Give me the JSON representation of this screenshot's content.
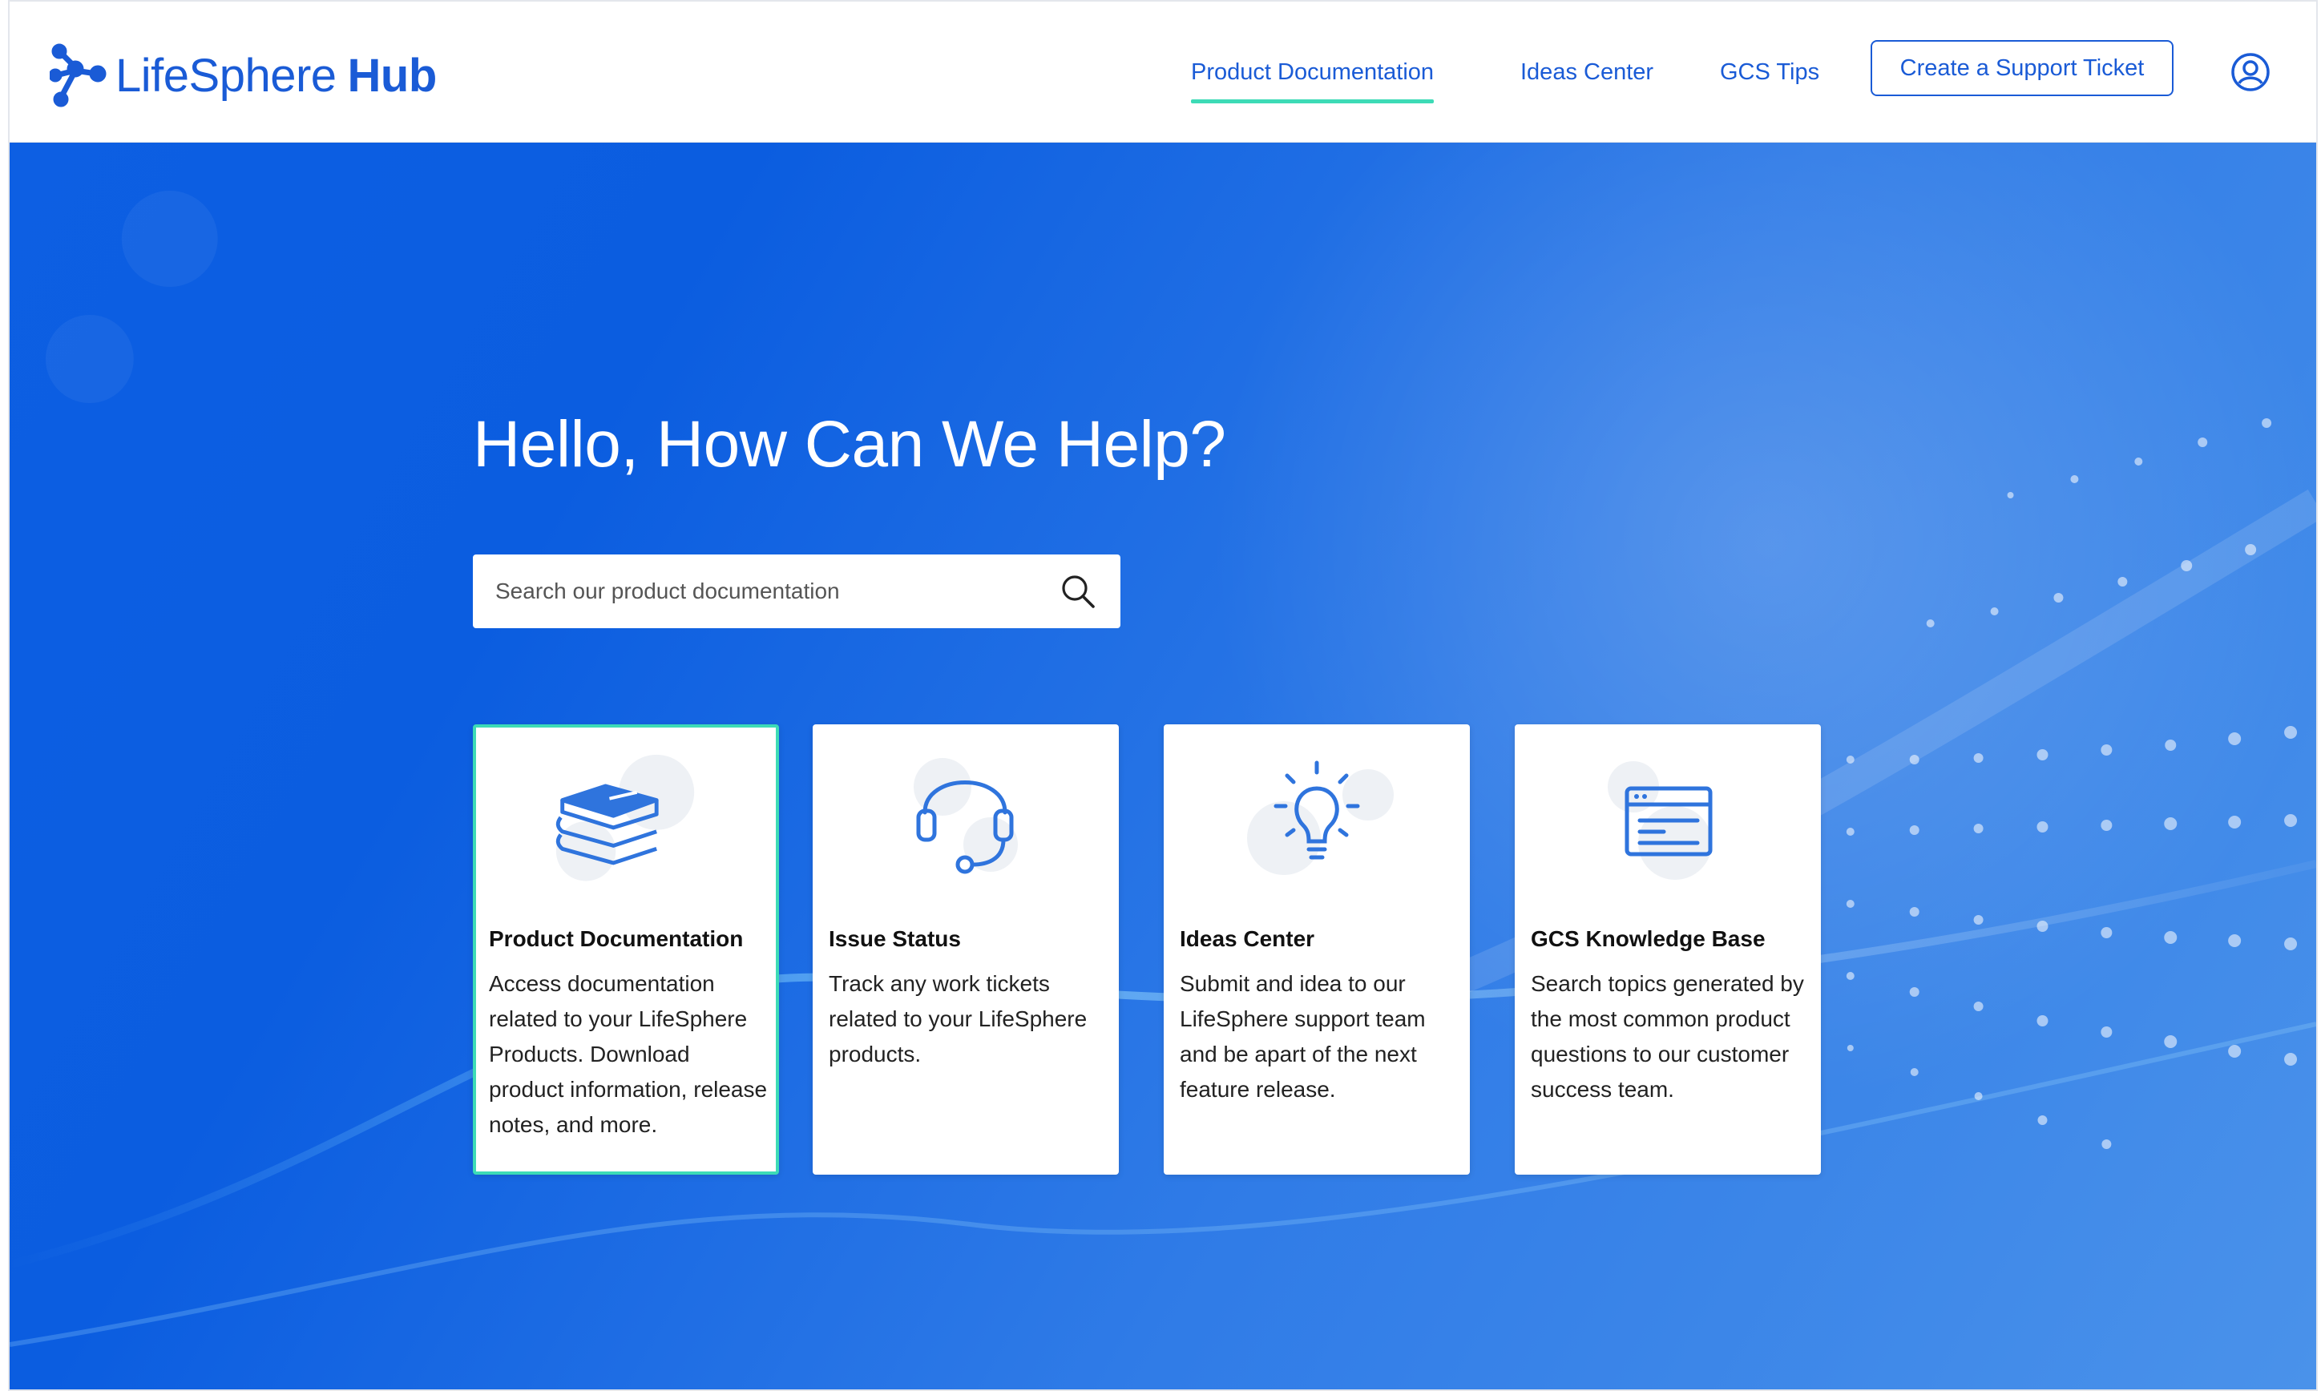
{
  "header": {
    "logo": {
      "light": "LifeSphere",
      "bold": "Hub"
    },
    "nav": [
      {
        "label": "Product Documentation",
        "active": true
      },
      {
        "label": "Ideas Center",
        "active": false
      },
      {
        "label": "GCS Tips",
        "active": false
      }
    ],
    "support_button": "Create a Support Ticket",
    "account_icon": "user-circle-icon"
  },
  "hero": {
    "title": "Hello, How Can We Help?",
    "search": {
      "placeholder": "Search our product documentation",
      "value": "",
      "icon": "search-icon"
    }
  },
  "cards": [
    {
      "title": "Product Documentation",
      "description": "Access documentation related to your LifeSphere Products. Download product information, release notes, and more.",
      "icon": "books-icon",
      "selected": true
    },
    {
      "title": "Issue Status",
      "description": "Track any work tickets related to your LifeSphere products.",
      "icon": "headset-icon",
      "selected": false
    },
    {
      "title": "Ideas Center",
      "description": "Submit and idea to our LifeSphere support team and be apart of the next feature release.",
      "icon": "lightbulb-icon",
      "selected": false
    },
    {
      "title": "GCS Knowledge Base",
      "description": "Search topics generated by the most common product questions to our customer success team.",
      "icon": "browser-window-icon",
      "selected": false
    }
  ],
  "colors": {
    "brand": "#1a5bd6",
    "accent": "#3ddbb6",
    "hero": "#0b5de0",
    "icon": "#2f74dd"
  }
}
